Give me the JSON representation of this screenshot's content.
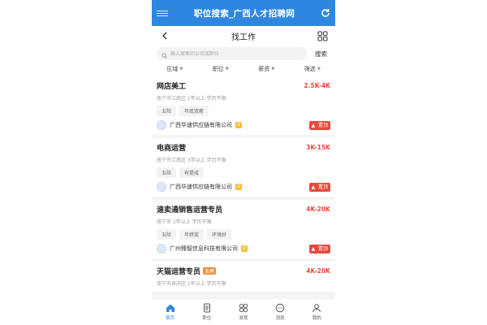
{
  "header": {
    "title": "职位搜索_广西人才招聘网"
  },
  "nav": {
    "title": "找工作"
  },
  "search": {
    "placeholder": "输入搜索的公司或职位",
    "button_label": "搜索"
  },
  "filters": [
    "区域",
    "职位",
    "薪资",
    "筛选"
  ],
  "jobs": [
    {
      "title": "网店美工",
      "salary": "2.5K-4K",
      "meta": "南宁市江南区 1年以上 学历不限",
      "tags": [
        "五险",
        "年底双薪"
      ],
      "company": "广西华速供应链有限公司",
      "badge": "置顶",
      "urgent": ""
    },
    {
      "title": "电商运营",
      "salary": "3K-15K",
      "meta": "南宁市江南区 3年以上 学历不限",
      "tags": [
        "五险",
        "有提成"
      ],
      "company": "广西华速供应链有限公司",
      "badge": "置顶",
      "urgent": ""
    },
    {
      "title": "速卖通销售运营专员",
      "salary": "4K-20K",
      "meta": "南宁市 1年以上 学历不限",
      "tags": [
        "五险",
        "年终奖",
        "环境好"
      ],
      "company": "广州臻智信息科技有限公司",
      "badge": "置顶",
      "urgent": ""
    },
    {
      "title": "天猫运营专员",
      "salary": "4K-20K",
      "meta": "南宁市良庆区 1年以上 学历不限",
      "tags": [],
      "company": "",
      "badge": "",
      "urgent": "急聘"
    }
  ],
  "tabbar": [
    {
      "label": "首页",
      "icon": "home-icon",
      "active": true
    },
    {
      "label": "职位",
      "icon": "document-icon",
      "active": false
    },
    {
      "label": "发现",
      "icon": "grid-icon",
      "active": false
    },
    {
      "label": "消息",
      "icon": "chat-icon",
      "active": false
    },
    {
      "label": "我的",
      "icon": "person-icon",
      "active": false
    }
  ],
  "colors": {
    "brand": "#2f86e0",
    "salary": "#e8493a",
    "urgent": "#f08a3c"
  }
}
